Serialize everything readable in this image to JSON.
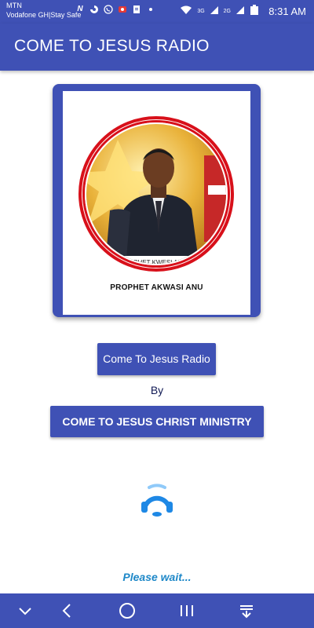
{
  "status_bar": {
    "carrier_line_1": "MTN",
    "carrier_line_2": "Vodafone GH|Stay Safe",
    "time": "8:31 AM",
    "notification_icons": [
      "n-icon",
      "swirl-icon",
      "whatsapp-icon",
      "record-icon",
      "document-icon",
      "dot-icon"
    ],
    "system_icons": [
      "wifi-icon",
      "signal-3g-icon",
      "signal-2g-icon",
      "battery-icon"
    ],
    "sys_labels": [
      "3G",
      "2G",
      "36"
    ]
  },
  "app_bar": {
    "title": "COME TO JESUS RADIO"
  },
  "card": {
    "caption": "PROPHET AKWASI ANU",
    "banner_text": "OPHET KWESI ANU"
  },
  "buttons": {
    "radio_label": "Come To Jesus Radio",
    "by_label": "By",
    "ministry_label": "COME TO JESUS CHRIST MINISTRY"
  },
  "loader": {
    "text": "Please wait..."
  },
  "nav_bar": {
    "icons": [
      "chevron-down-icon",
      "back-icon",
      "home-icon",
      "recents-icon",
      "pull-down-icon"
    ]
  },
  "colors": {
    "primary": "#3f51b5",
    "accent_text": "#1e88c8",
    "ring_red": "#d8101a"
  }
}
